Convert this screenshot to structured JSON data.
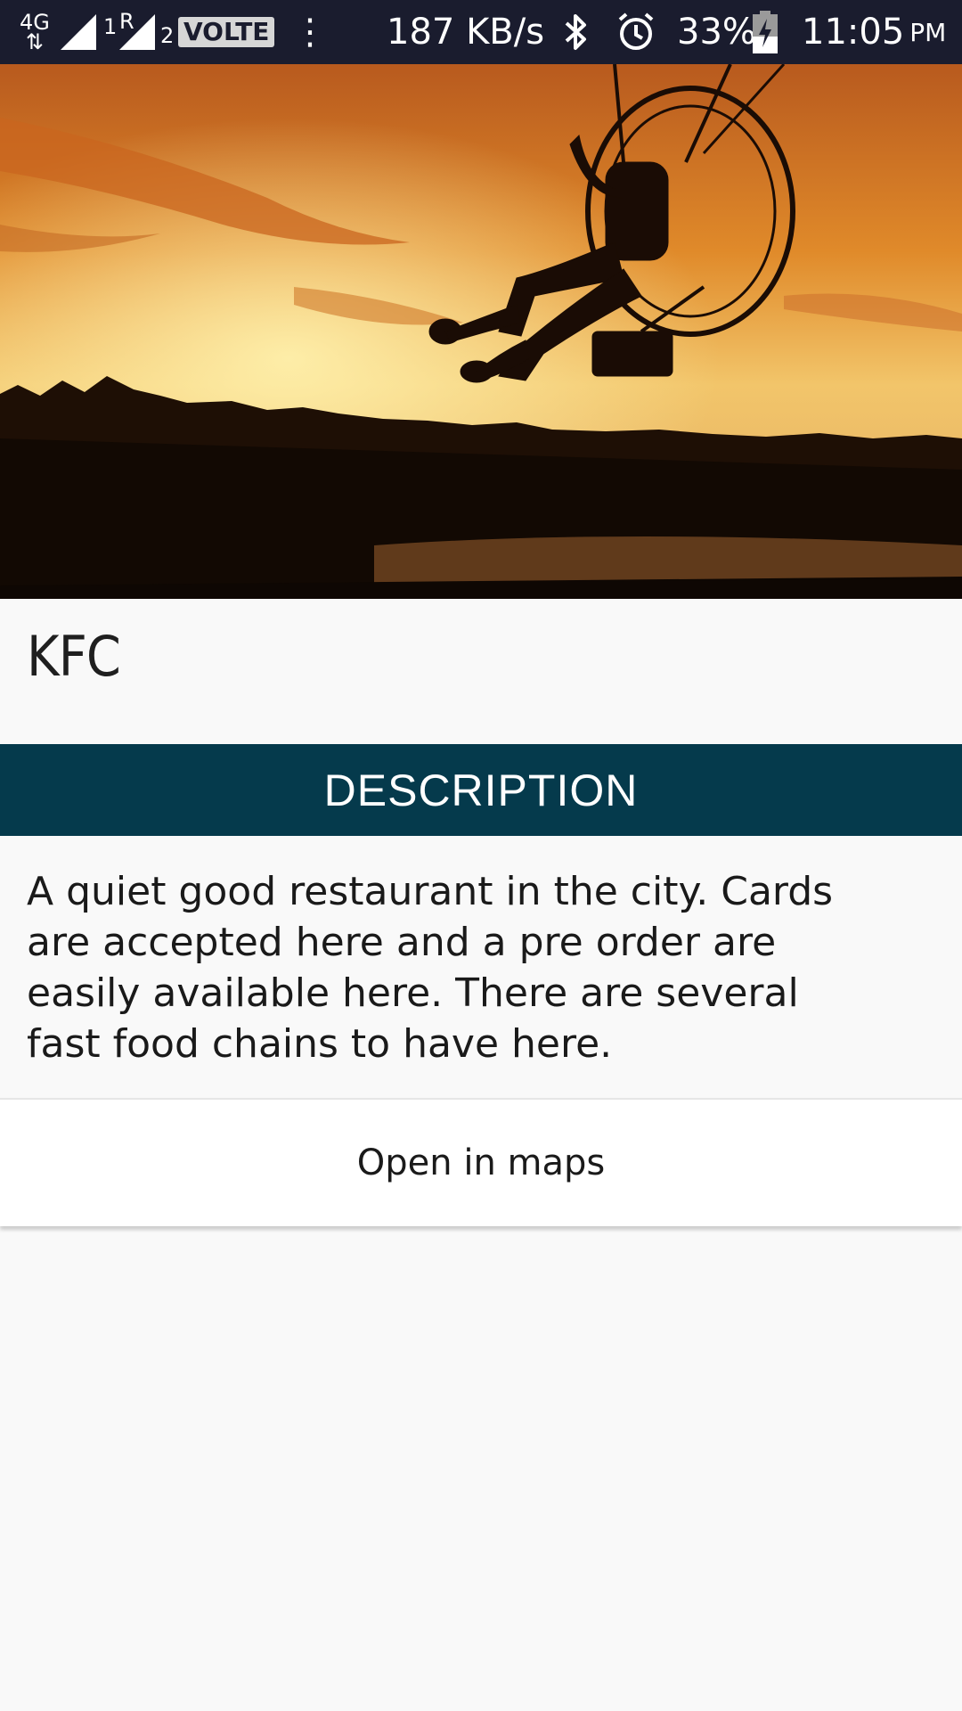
{
  "status_bar": {
    "network_type": "4G",
    "sim1_label": "1",
    "roaming_label": "R",
    "sim2_label": "2",
    "volte_label": "VOLTE",
    "data_speed": "187 KB/s",
    "battery_percent": "33%",
    "time": "11:05",
    "ampm": "PM",
    "icons": [
      "signal-icon",
      "overflow-dots-icon",
      "bluetooth-icon",
      "alarm-icon",
      "battery-charging-icon"
    ]
  },
  "hero": {
    "image": "paramotor-sunset-photo"
  },
  "place": {
    "title": "KFC"
  },
  "description": {
    "header": "DESCRIPTION",
    "text": "A quiet good restaurant in the city. Cards are accepted here and a pre order are easily available here. There are several fast food chains to have here."
  },
  "actions": {
    "open_maps_label": "Open in maps"
  },
  "colors": {
    "status_bar_bg": "#1a1c2e",
    "description_bar_bg": "#053a4c",
    "page_bg": "#f9f9f9"
  }
}
